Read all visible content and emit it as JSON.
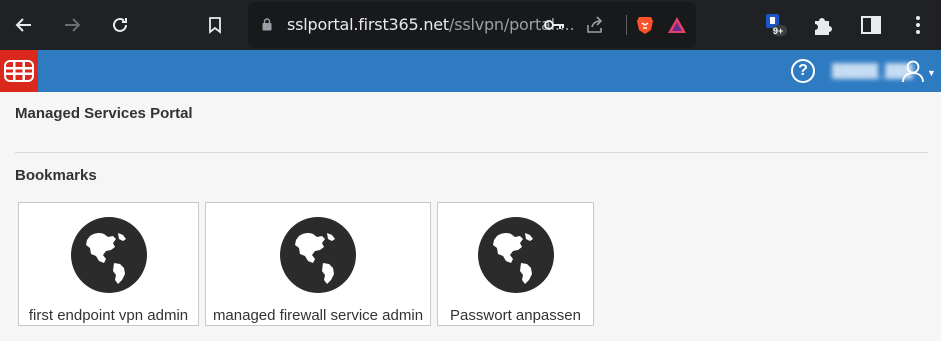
{
  "browser": {
    "url_host": "sslportal.first365.net",
    "url_path": "/sslvpn/portal....",
    "extension_badge": "9+",
    "icons": {
      "back": "arrow-left-icon",
      "forward": "arrow-right-icon",
      "reload": "reload-icon",
      "bookmark": "bookmark-icon",
      "lock": "lock-icon",
      "key": "key-icon",
      "share": "share-icon",
      "brave": "brave-lion-icon",
      "rewards": "triangle-icon",
      "extensions": "puzzle-icon",
      "sidebar": "sidebar-icon",
      "menu": "kebab-menu-icon"
    }
  },
  "header": {
    "username": "█████_███",
    "help_symbol": "?",
    "colors": {
      "bar": "#2e7bc2",
      "logo": "#da291c"
    }
  },
  "main": {
    "title": "Managed Services Portal",
    "bookmarks_heading": "Bookmarks",
    "bookmarks": [
      {
        "label": "first endpoint vpn admin",
        "icon": "globe-icon"
      },
      {
        "label": "managed firewall service admin",
        "icon": "globe-icon"
      },
      {
        "label": "Passwort anpassen",
        "icon": "globe-icon"
      }
    ]
  }
}
